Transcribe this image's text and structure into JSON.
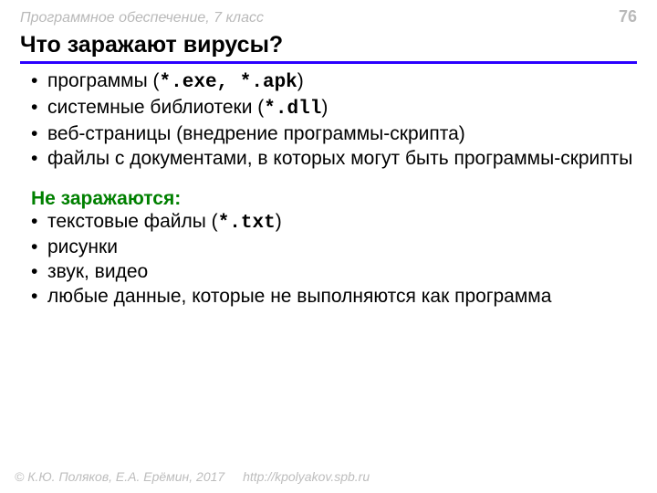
{
  "header": {
    "course": "Программное обеспечение, 7 класс",
    "page": "76"
  },
  "title": "Что заражают вирусы?",
  "infected": [
    {
      "before": "программы (",
      "code": "*.exe, *.apk",
      "after": ")"
    },
    {
      "before": "системные библиотеки (",
      "code": "*.dll",
      "after": ")"
    },
    {
      "before": "веб-страницы (внедрение программы-скрипта)",
      "code": "",
      "after": ""
    },
    {
      "before": "файлы с документами, в которых могут быть программы-скрипты",
      "code": "",
      "after": ""
    }
  ],
  "not_infected_label": "Не заражаются:",
  "not_infected": [
    {
      "before": "текстовые файлы (",
      "code": "*.txt",
      "after": ")"
    },
    {
      "before": "рисунки",
      "code": "",
      "after": ""
    },
    {
      "before": "звук, видео",
      "code": "",
      "after": ""
    },
    {
      "before": "любые данные, которые не выполняются как программа",
      "code": "",
      "after": ""
    }
  ],
  "footer": {
    "copyright": "© К.Ю. Поляков, Е.А. Ерёмин, 2017",
    "url": "http://kpolyakov.spb.ru"
  }
}
